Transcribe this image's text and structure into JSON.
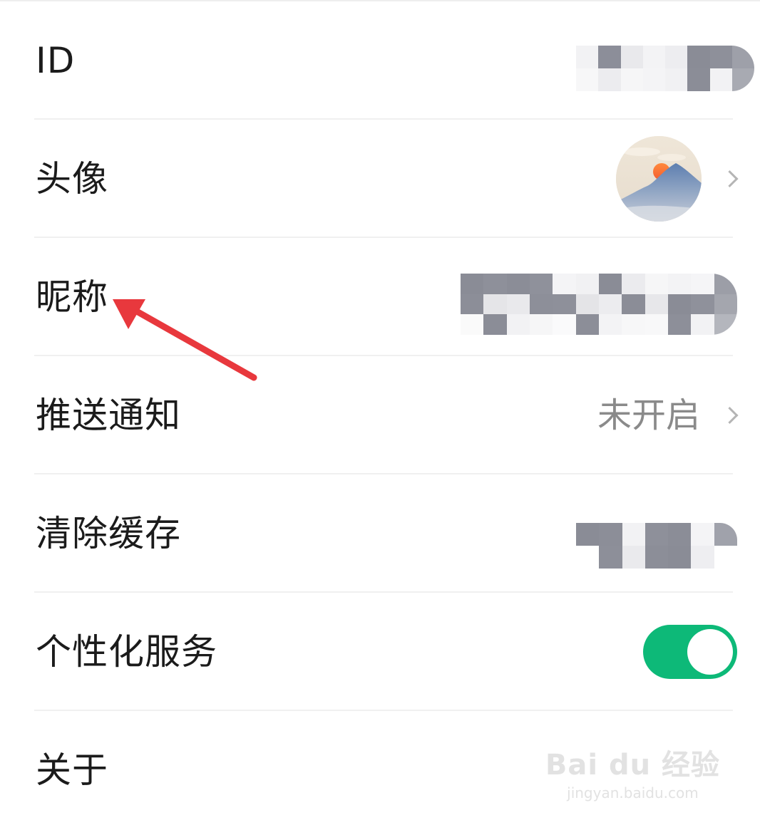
{
  "settings": {
    "rows": [
      {
        "label": "ID"
      },
      {
        "label": "头像"
      },
      {
        "label": "昵称"
      },
      {
        "label": "推送通知",
        "value": "未开启"
      },
      {
        "label": "清除缓存"
      },
      {
        "label": "个性化服务",
        "toggle_on": true
      },
      {
        "label": "关于"
      }
    ]
  },
  "colors": {
    "toggle_on": "#0db978",
    "annotation_arrow": "#e8383d",
    "label_text": "#1b1b1b",
    "value_text": "#8a8a8a"
  },
  "icons": {
    "chevron": "chevron-right-icon",
    "avatar": "mountain-sun-avatar",
    "annotation": "red-arrow"
  },
  "watermark": {
    "logo": "Bai du 经验",
    "url": "jingyan.baidu.com"
  }
}
